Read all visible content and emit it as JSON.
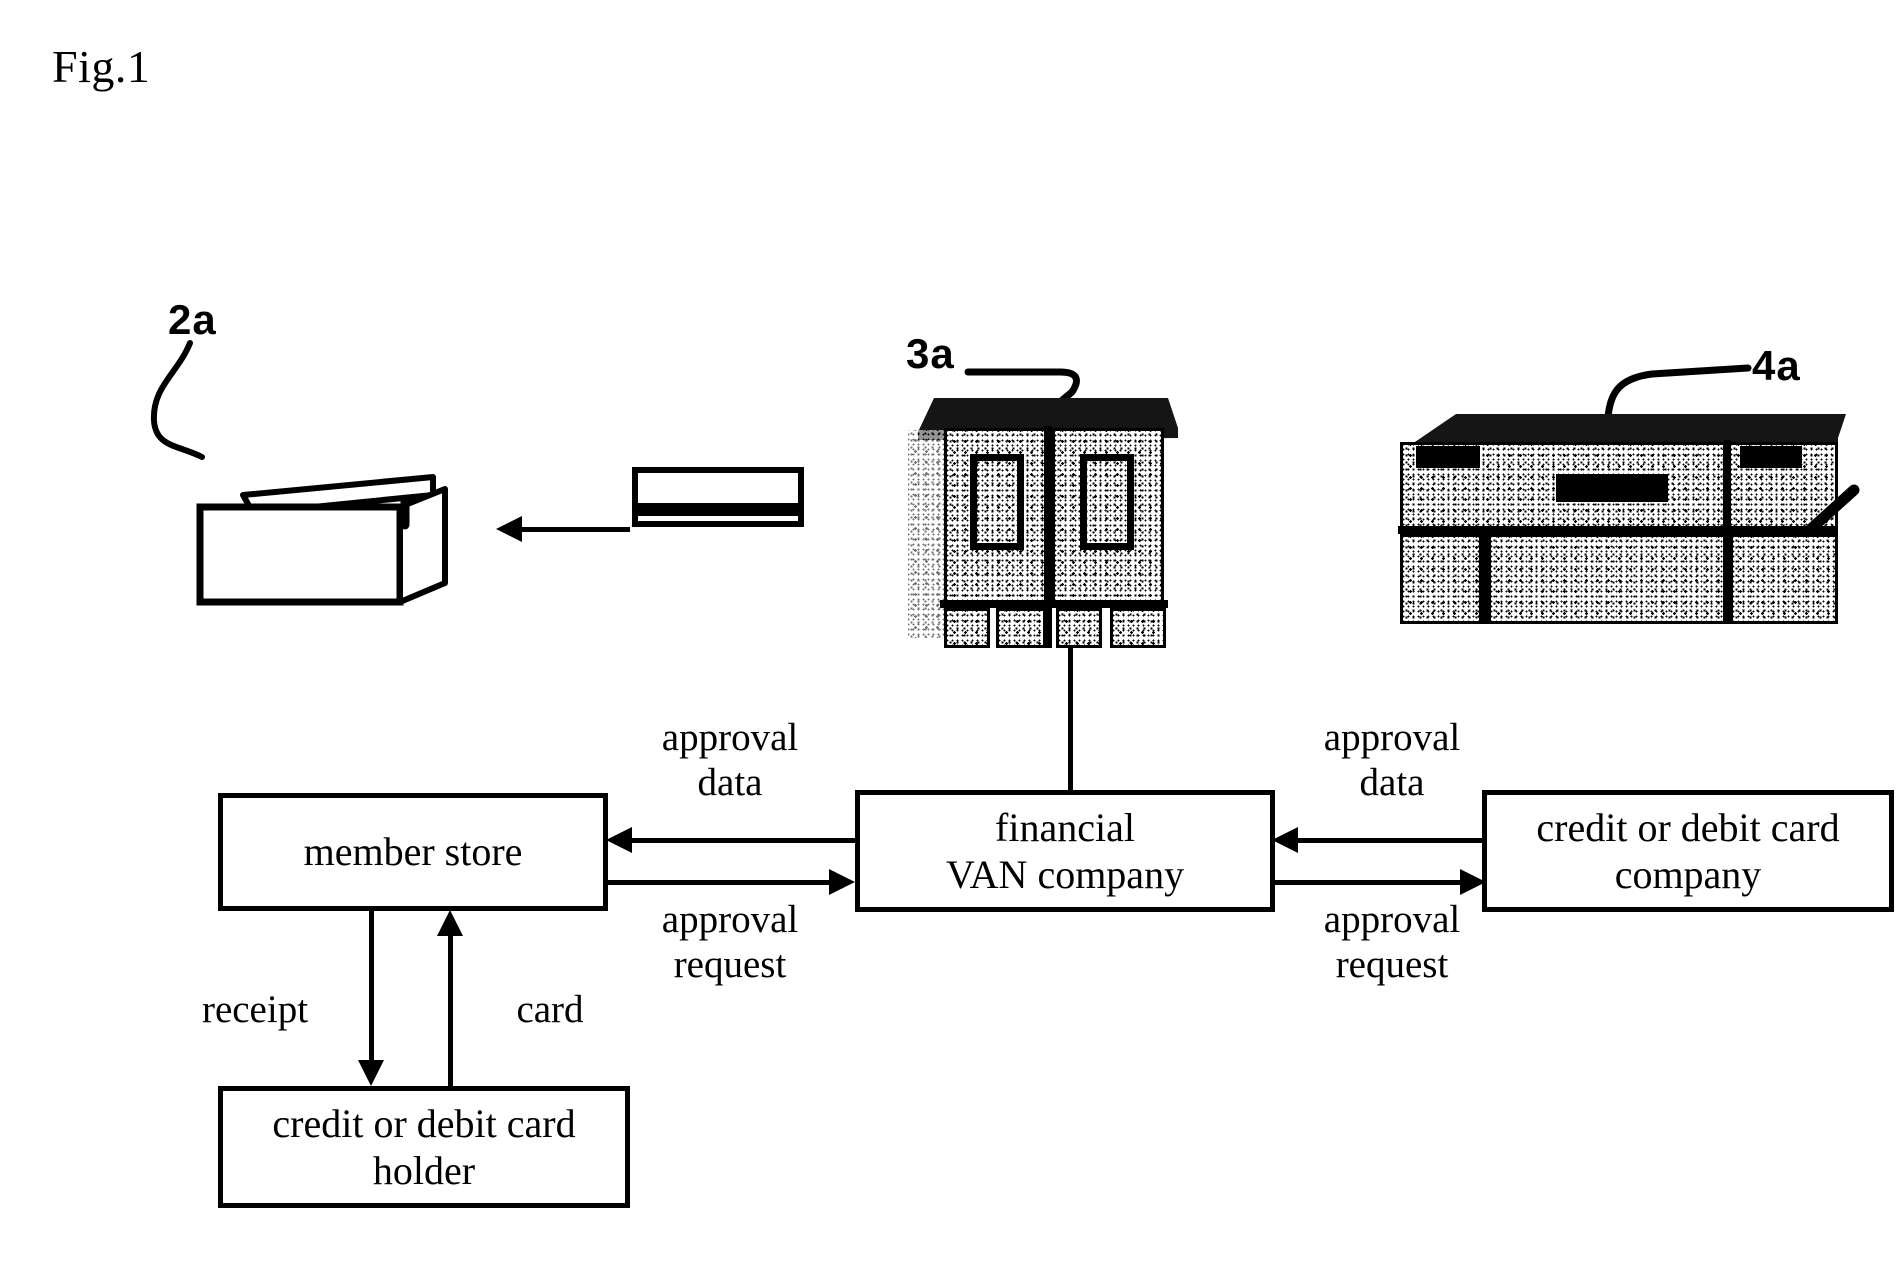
{
  "figure": {
    "label": "Fig.1",
    "type": "patent-flow-diagram"
  },
  "reference_numerals": [
    {
      "id": "ref-2a",
      "text": "2a",
      "points_to": "card-reader-terminal"
    },
    {
      "id": "ref-3a",
      "text": "3a",
      "points_to": "financial-van-server"
    },
    {
      "id": "ref-4a",
      "text": "4a",
      "points_to": "card-company-mainframe"
    }
  ],
  "boxes": {
    "member_store": "member store",
    "financial_van": "financial\nVAN company",
    "card_company": "credit or debit card\ncompany",
    "card_holder": "credit or debit card\nholder"
  },
  "edge_labels": {
    "approval_data_left": "approval\ndata",
    "approval_request_left": "approval\nrequest",
    "approval_data_right": "approval\ndata",
    "approval_request_right": "approval\nrequest",
    "receipt": "receipt",
    "card": "card"
  },
  "illustrations": {
    "card_reader": "card-reader-terminal",
    "magnetic_card": "credit-debit-card",
    "van_server": "financial-van-server-cabinets",
    "card_company_mainframe": "credit-card-company-mainframe"
  },
  "colors": {
    "ink": "#000000",
    "paper": "#ffffff"
  }
}
